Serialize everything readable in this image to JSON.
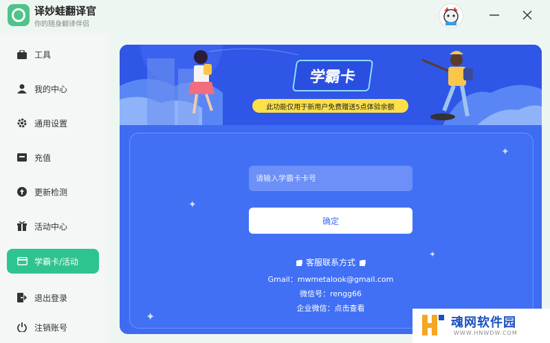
{
  "app": {
    "title": "译妙蛙翻译官",
    "subtitle": "你的随身翻译伴侣"
  },
  "sidebar": {
    "items": [
      {
        "label": "工具",
        "icon": "toolbox-icon"
      },
      {
        "label": "我的中心",
        "icon": "user-icon"
      },
      {
        "label": "通用设置",
        "icon": "gear-icon"
      },
      {
        "label": "充值",
        "icon": "wallet-icon"
      },
      {
        "label": "更新检测",
        "icon": "upload-arrow-icon"
      },
      {
        "label": "活动中心",
        "icon": "gift-icon"
      },
      {
        "label": "学霸卡/活动",
        "icon": "card-icon",
        "active": true
      },
      {
        "label": "退出登录",
        "icon": "logout-icon"
      },
      {
        "label": "注销账号",
        "icon": "power-icon"
      }
    ]
  },
  "banner": {
    "card_title": "学霸卡",
    "promo": "此功能仅用于新用户免费赠送5点体验余额"
  },
  "form": {
    "placeholder": "请输入学霸卡卡号",
    "value": "",
    "confirm_label": "确定"
  },
  "support": {
    "title": "客服联系方式",
    "gmail": "Gmail：mwmetalook@gmail.com",
    "wechat": "微信号：rengg66",
    "enterprise": "企业微信：点击查看"
  },
  "watermark": {
    "name": "魂网软件园",
    "url": "WWW.HNWDW.COM"
  },
  "colors": {
    "accent": "#2ec48f",
    "panel": "#3d6cf2",
    "promo": "#fbe04a"
  }
}
